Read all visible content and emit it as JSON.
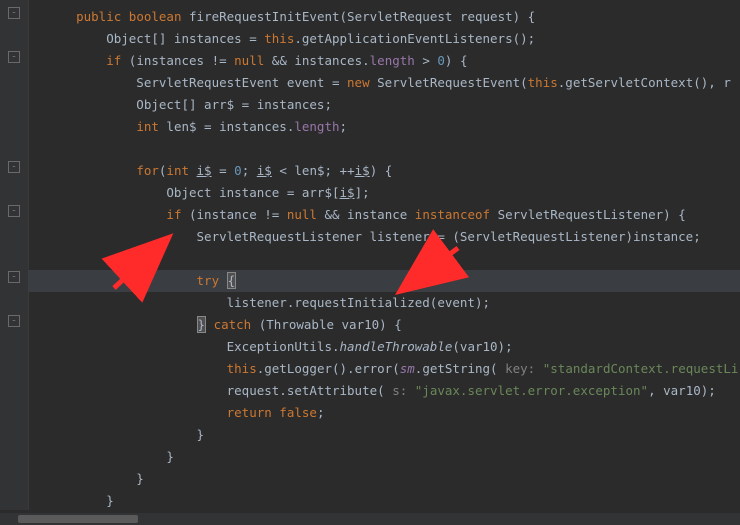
{
  "code": {
    "lines": [
      {
        "indent": 1,
        "tokens": [
          [
            "kw",
            "public "
          ],
          [
            "kw",
            "boolean "
          ],
          [
            "method",
            "fireRequestInitEvent"
          ],
          [
            "plain",
            "(ServletRequest request) {"
          ]
        ]
      },
      {
        "indent": 2,
        "tokens": [
          [
            "plain",
            "Object[] instances = "
          ],
          [
            "kw",
            "this"
          ],
          [
            "plain",
            "."
          ],
          [
            "call",
            "getApplicationEventListeners"
          ],
          [
            "plain",
            "();"
          ]
        ]
      },
      {
        "indent": 2,
        "tokens": [
          [
            "kw",
            "if "
          ],
          [
            "plain",
            "(instances != "
          ],
          [
            "kw",
            "null "
          ],
          [
            "plain",
            "&& instances."
          ],
          [
            "fld",
            "length "
          ],
          [
            "plain",
            "> "
          ],
          [
            "num",
            "0"
          ],
          [
            "plain",
            ") {"
          ]
        ]
      },
      {
        "indent": 3,
        "tokens": [
          [
            "plain",
            "ServletRequestEvent event = "
          ],
          [
            "kw",
            "new "
          ],
          [
            "plain",
            "ServletRequestEvent("
          ],
          [
            "kw",
            "this"
          ],
          [
            "plain",
            "."
          ],
          [
            "call",
            "getServletContext"
          ],
          [
            "plain",
            "(), "
          ],
          [
            "trail",
            "r"
          ]
        ]
      },
      {
        "indent": 3,
        "tokens": [
          [
            "plain",
            "Object[] arr$ = instances;"
          ]
        ]
      },
      {
        "indent": 3,
        "tokens": [
          [
            "kw",
            "int "
          ],
          [
            "plain",
            "len$ = instances."
          ],
          [
            "fld",
            "length"
          ],
          [
            "plain",
            ";"
          ]
        ]
      },
      {
        "indent": 0,
        "tokens": [
          [
            "plain",
            ""
          ]
        ]
      },
      {
        "indent": 3,
        "tokens": [
          [
            "kw",
            "for"
          ],
          [
            "plain",
            "("
          ],
          [
            "kw",
            "int "
          ],
          [
            "varu",
            "i$"
          ],
          [
            "plain",
            " = "
          ],
          [
            "num",
            "0"
          ],
          [
            "plain",
            "; "
          ],
          [
            "varu",
            "i$"
          ],
          [
            "plain",
            " < len$; ++"
          ],
          [
            "varu",
            "i$"
          ],
          [
            "plain",
            ") {"
          ]
        ]
      },
      {
        "indent": 4,
        "tokens": [
          [
            "plain",
            "Object instance = arr$["
          ],
          [
            "varu",
            "i$"
          ],
          [
            "plain",
            "];"
          ]
        ]
      },
      {
        "indent": 4,
        "tokens": [
          [
            "kw",
            "if "
          ],
          [
            "plain",
            "(instance != "
          ],
          [
            "kw",
            "null "
          ],
          [
            "plain",
            "&& instance "
          ],
          [
            "kw",
            "instanceof "
          ],
          [
            "plain",
            "ServletRequestListener) {"
          ]
        ]
      },
      {
        "indent": 5,
        "tokens": [
          [
            "plain",
            "ServletRequestListener listener = (ServletRequestListener)instance;"
          ]
        ]
      },
      {
        "indent": 0,
        "tokens": [
          [
            "plain",
            ""
          ]
        ]
      },
      {
        "indent": 5,
        "tokens": [
          [
            "kw",
            "try "
          ],
          [
            "brace",
            "{"
          ]
        ]
      },
      {
        "indent": 6,
        "tokens": [
          [
            "plain",
            "listener."
          ],
          [
            "call",
            "requestInitialized"
          ],
          [
            "plain",
            "(event);"
          ]
        ]
      },
      {
        "indent": 5,
        "tokens": [
          [
            "brace",
            "}"
          ],
          [
            "plain",
            " "
          ],
          [
            "kw",
            "catch "
          ],
          [
            "plain",
            "(Throwable var10) {"
          ]
        ]
      },
      {
        "indent": 6,
        "tokens": [
          [
            "plain",
            "ExceptionUtils."
          ],
          [
            "sta",
            "handleThrowable"
          ],
          [
            "plain",
            "(var10);"
          ]
        ]
      },
      {
        "indent": 6,
        "tokens": [
          [
            "kw",
            "this"
          ],
          [
            "plain",
            "."
          ],
          [
            "call",
            "getLogger"
          ],
          [
            "plain",
            "()."
          ],
          [
            "call",
            "error"
          ],
          [
            "plain",
            "("
          ],
          [
            "fldi",
            "sm"
          ],
          [
            "plain",
            "."
          ],
          [
            "call",
            "getString"
          ],
          [
            "plain",
            "( "
          ],
          [
            "cmt",
            "key: "
          ],
          [
            "str",
            "\"standardContext.requestLi"
          ]
        ]
      },
      {
        "indent": 6,
        "tokens": [
          [
            "plain",
            "request."
          ],
          [
            "call",
            "setAttribute"
          ],
          [
            "plain",
            "( "
          ],
          [
            "cmt",
            "s: "
          ],
          [
            "str",
            "\"javax.servlet.error.exception\""
          ],
          [
            "plain",
            ", var10);"
          ]
        ]
      },
      {
        "indent": 6,
        "tokens": [
          [
            "kw",
            "return false"
          ],
          [
            "plain",
            ";"
          ]
        ]
      },
      {
        "indent": 5,
        "tokens": [
          [
            "plain",
            "}"
          ]
        ]
      },
      {
        "indent": 4,
        "tokens": [
          [
            "plain",
            "}"
          ]
        ]
      },
      {
        "indent": 3,
        "tokens": [
          [
            "plain",
            "}"
          ]
        ]
      },
      {
        "indent": 2,
        "tokens": [
          [
            "plain",
            "}"
          ]
        ]
      }
    ]
  },
  "colors": {
    "bg": "#2b2b2b",
    "gutter": "#313335",
    "keyword": "#cc7832",
    "number": "#6897bb",
    "field": "#9876aa",
    "string": "#6a8759",
    "hint": "#808080",
    "text": "#a9b7c6",
    "arrow": "#ff2a2a"
  },
  "annotations": {
    "arrow_color": "#ff2a2a",
    "arrow_count": 2
  },
  "language": "Java",
  "editor": "IntelliJ IDEA (Darcula)"
}
